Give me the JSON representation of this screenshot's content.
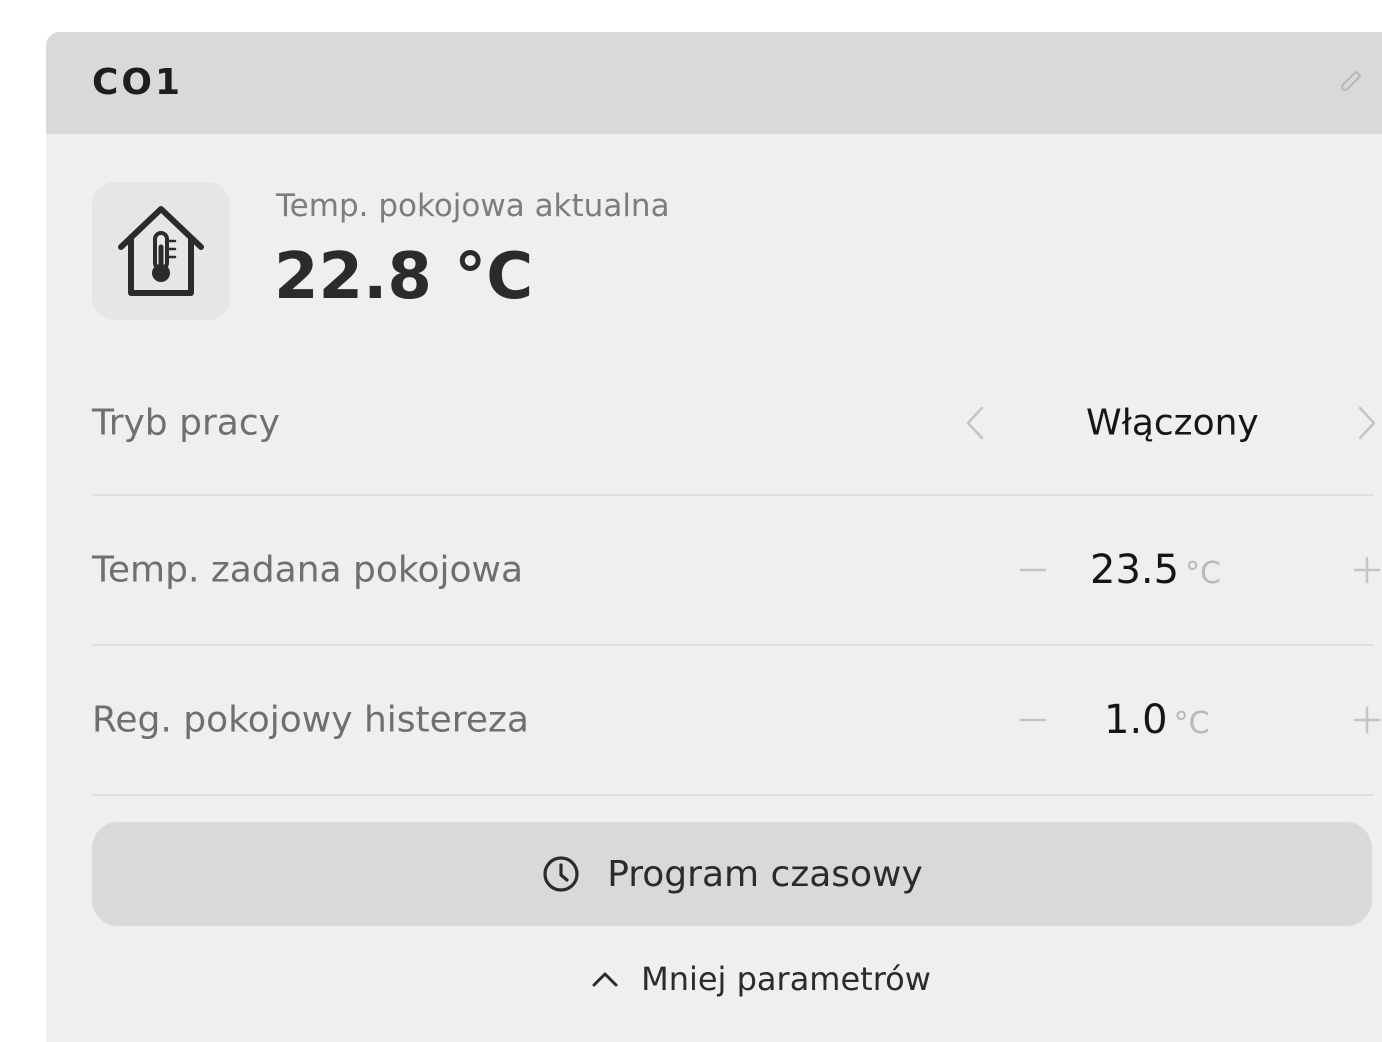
{
  "card": {
    "title": "CO1"
  },
  "current_temp": {
    "label": "Temp. pokojowa aktualna",
    "value": "22.8 °C",
    "icon": "house-thermometer-icon"
  },
  "params": {
    "mode": {
      "label": "Tryb pracy",
      "value": "Włączony"
    },
    "setpoint": {
      "label": "Temp. zadana pokojowa",
      "value": "23.5",
      "unit": "°C"
    },
    "hysteresis": {
      "label": "Reg. pokojowy histereza",
      "value": "1.0",
      "unit": "°C"
    }
  },
  "actions": {
    "program_label": "Program czasowy",
    "less_label": "Mniej parametrów"
  },
  "colors": {
    "card_bg": "#efefef",
    "header_bg": "#d9d9d9",
    "button_bg": "#d9d9d9",
    "muted_control": "#c4c4c4"
  }
}
